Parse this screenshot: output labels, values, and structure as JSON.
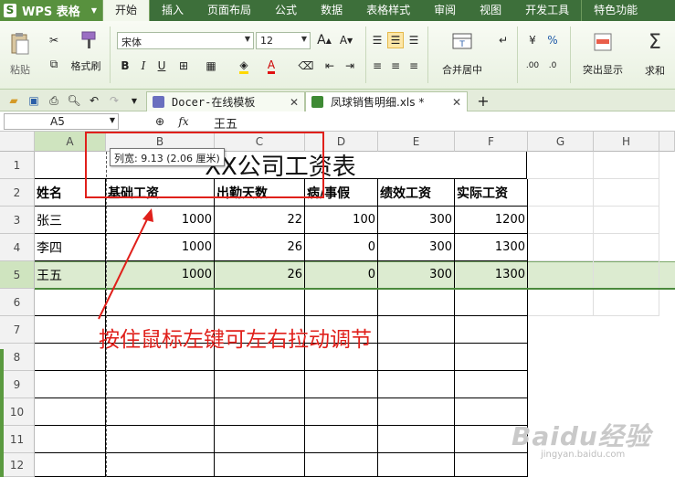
{
  "app": {
    "name": "WPS 表格",
    "logo": "S"
  },
  "menu": {
    "tabs": [
      "开始",
      "插入",
      "页面布局",
      "公式",
      "数据",
      "表格样式",
      "审阅",
      "视图",
      "开发工具"
    ],
    "active": "开始",
    "special": "特色功能"
  },
  "ribbon": {
    "paste": "粘贴",
    "format_painter": "格式刷",
    "font_name": "宋体",
    "font_size": "12",
    "merge_center": "合并居中",
    "highlight": "突出显示",
    "sum": "求和",
    "bold": "B",
    "italic": "I",
    "underline": "U",
    "percent": "%",
    "font_color_letter": "A",
    "inc_font": "A",
    "dec_font": "A"
  },
  "doc_tabs": [
    {
      "label": "Docer-在线模板"
    },
    {
      "label": "凤球销售明细.xls *"
    }
  ],
  "formula_bar": {
    "name_box": "A5",
    "content": "王五",
    "fx": "fx"
  },
  "columns": [
    "A",
    "B",
    "C",
    "D",
    "E",
    "F",
    "G",
    "H"
  ],
  "rows": [
    "1",
    "2",
    "3",
    "4",
    "5",
    "6",
    "7",
    "8",
    "9",
    "10",
    "11",
    "12"
  ],
  "sheet": {
    "title": "XX公司工资表",
    "headers": [
      "姓名",
      "基础工资",
      "出勤天数",
      "病/事假",
      "绩效工资",
      "实际工资"
    ],
    "data": [
      [
        "张三",
        "1000",
        "22",
        "100",
        "300",
        "1200"
      ],
      [
        "李四",
        "1000",
        "26",
        "0",
        "300",
        "1300"
      ],
      [
        "王五",
        "1000",
        "26",
        "0",
        "300",
        "1300"
      ]
    ]
  },
  "tooltip": "列宽: 9.13 (2.06 厘米)",
  "annotation": "按住鼠标左键可左右拉动调节",
  "watermark": "Baidu经验",
  "watermark_sub": "jingyan.baidu.com",
  "colors": {
    "menu_bg": "#3d6f3a",
    "accent_green": "#58913e",
    "annotation_red": "#e0201b",
    "selection_row": "#dcebd0"
  }
}
